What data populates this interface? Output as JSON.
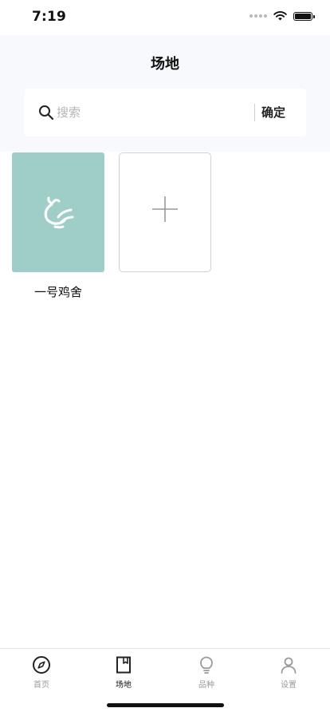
{
  "status_bar": {
    "time": "7:19"
  },
  "header": {
    "title": "场地"
  },
  "search": {
    "placeholder": "搜索",
    "value": "",
    "confirm_label": "确定"
  },
  "sites": [
    {
      "name": "一号鸡舍",
      "icon": "rooster-icon",
      "color": "#9fcec8"
    }
  ],
  "add_card": {
    "icon": "plus-icon"
  },
  "tab_bar": {
    "items": [
      {
        "label": "首页",
        "icon": "compass-icon",
        "active": false
      },
      {
        "label": "场地",
        "icon": "book-icon",
        "active": true
      },
      {
        "label": "品种",
        "icon": "lightbulb-icon",
        "active": false
      },
      {
        "label": "设置",
        "icon": "user-icon",
        "active": false
      }
    ]
  },
  "colors": {
    "accent": "#9fcec8",
    "header_bg": "#f8f9fc"
  }
}
